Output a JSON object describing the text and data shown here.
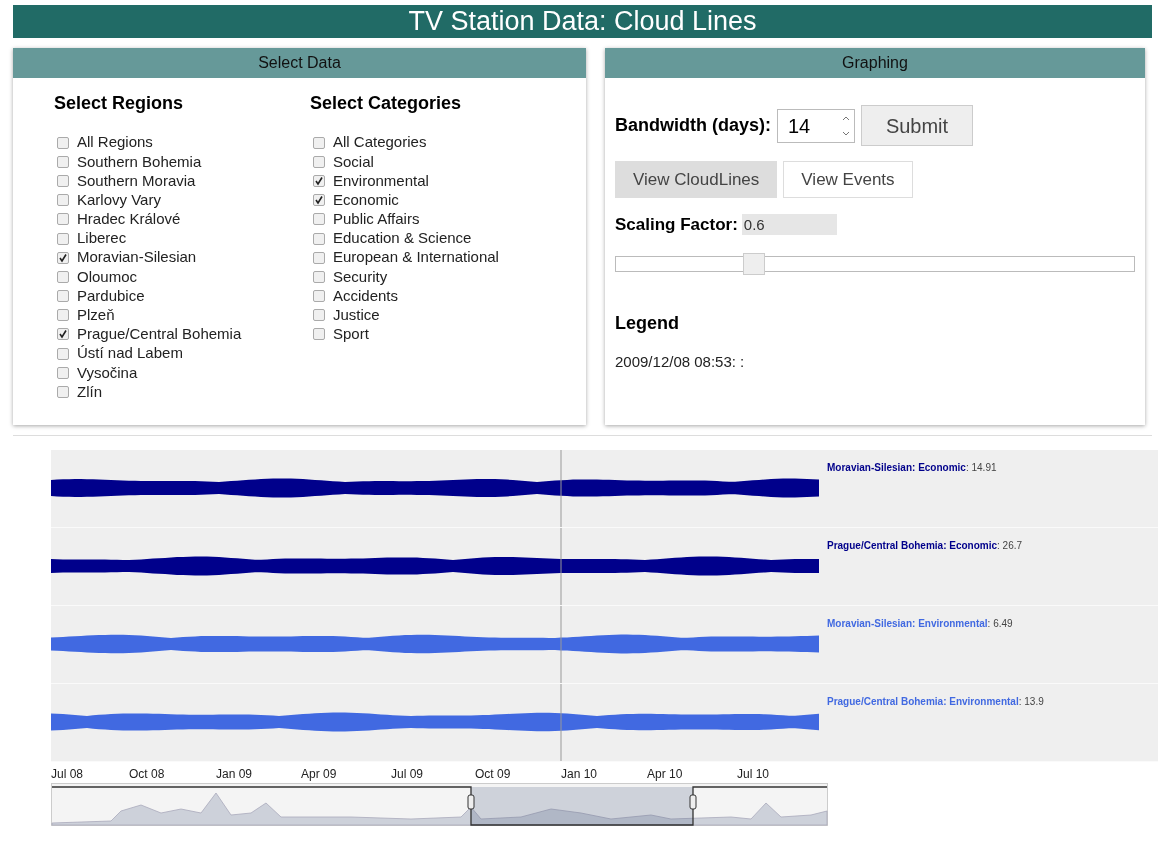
{
  "title": "TV Station Data: Cloud Lines",
  "select_data": {
    "header": "Select Data",
    "regions": {
      "heading": "Select Regions",
      "items": [
        {
          "label": "All Regions",
          "checked": false
        },
        {
          "label": "Southern Bohemia",
          "checked": false
        },
        {
          "label": "Southern Moravia",
          "checked": false
        },
        {
          "label": "Karlovy Vary",
          "checked": false
        },
        {
          "label": "Hradec Králové",
          "checked": false
        },
        {
          "label": "Liberec",
          "checked": false
        },
        {
          "label": "Moravian-Silesian",
          "checked": true
        },
        {
          "label": "Oloumoc",
          "checked": false
        },
        {
          "label": "Pardubice",
          "checked": false
        },
        {
          "label": "Plzeň",
          "checked": false
        },
        {
          "label": "Prague/Central Bohemia",
          "checked": true
        },
        {
          "label": "Ústí nad Labem",
          "checked": false
        },
        {
          "label": "Vysočina",
          "checked": false
        },
        {
          "label": "Zlín",
          "checked": false
        }
      ]
    },
    "categories": {
      "heading": "Select Categories",
      "items": [
        {
          "label": "All Categories",
          "checked": false
        },
        {
          "label": "Social",
          "checked": false
        },
        {
          "label": "Environmental",
          "checked": true
        },
        {
          "label": "Economic",
          "checked": true
        },
        {
          "label": "Public Affairs",
          "checked": false
        },
        {
          "label": "Education & Science",
          "checked": false
        },
        {
          "label": "European & International",
          "checked": false
        },
        {
          "label": "Security",
          "checked": false
        },
        {
          "label": "Accidents",
          "checked": false
        },
        {
          "label": "Justice",
          "checked": false
        },
        {
          "label": "Sport",
          "checked": false
        }
      ]
    }
  },
  "graphing": {
    "header": "Graphing",
    "bandwidth": {
      "label": "Bandwidth (days):",
      "value": "14"
    },
    "submit": "Submit",
    "views": [
      {
        "label": "View CloudLines",
        "selected": true
      },
      {
        "label": "View Events",
        "selected": false
      }
    ],
    "scaling": {
      "label": "Scaling Factor:",
      "value": "0.6",
      "level": 0.265
    },
    "legend": {
      "heading": "Legend",
      "text": "2009/12/08 08:53: :"
    }
  },
  "cloud_lines": {
    "rows": [
      {
        "label": "**Moravian-Silesian: Economic**: 14.91",
        "color": "#00008b"
      },
      {
        "label": "**Prague/Central Bohemia: Economic**: 26.7",
        "color": "#00008b"
      },
      {
        "label": "**Moravian-Silesian: Environmental**: 6.49",
        "color": "#4169e1"
      },
      {
        "label": "**Prague/Central Bohemia: Environmental**: 13.9",
        "color": "#4169e1"
      }
    ],
    "x_labels": [
      "Jul 08",
      "Oct 08",
      "Jan 09",
      "Apr 09",
      "Jul 09",
      "Oct 09",
      "Jan 10",
      "Apr 10",
      "Jul 10"
    ]
  }
}
